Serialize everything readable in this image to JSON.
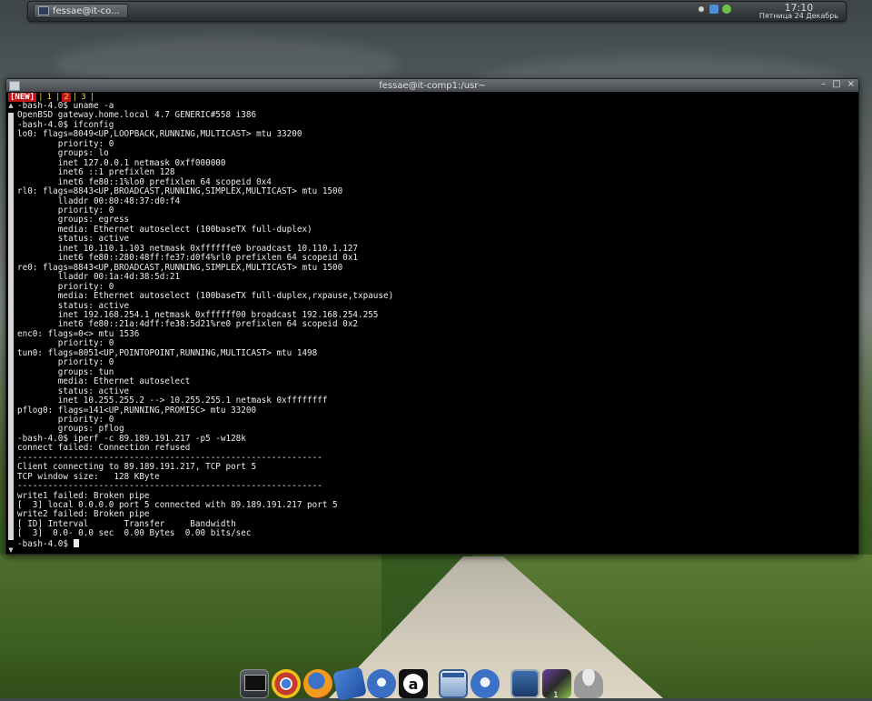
{
  "panel": {
    "task_label": "fessae@it-co...",
    "clock_time": "17:10",
    "clock_date": "Пятница 24 Декабрь"
  },
  "window": {
    "title": "fessae@it-comp1:/usr~",
    "controls": {
      "minimize": "–",
      "maximize": "□",
      "close": "×"
    }
  },
  "tabs": {
    "new_label": "[NEW]",
    "items": [
      "1",
      "2",
      "3"
    ]
  },
  "terminal_lines": [
    "-bash-4.0$ uname -a",
    "OpenBSD gateway.home.local 4.7 GENERIC#558 i386",
    "-bash-4.0$ ifconfig",
    "lo0: flags=8049<UP,LOOPBACK,RUNNING,MULTICAST> mtu 33200",
    "        priority: 0",
    "        groups: lo",
    "        inet 127.0.0.1 netmask 0xff000000",
    "        inet6 ::1 prefixlen 128",
    "        inet6 fe80::1%lo0 prefixlen 64 scopeid 0x4",
    "rl0: flags=8843<UP,BROADCAST,RUNNING,SIMPLEX,MULTICAST> mtu 1500",
    "        lladdr 00:80:48:37:d0:f4",
    "        priority: 0",
    "        groups: egress",
    "        media: Ethernet autoselect (100baseTX full-duplex)",
    "        status: active",
    "        inet 10.110.1.103 netmask 0xffffffe0 broadcast 10.110.1.127",
    "        inet6 fe80::280:48ff:fe37:d0f4%rl0 prefixlen 64 scopeid 0x1",
    "re0: flags=8843<UP,BROADCAST,RUNNING,SIMPLEX,MULTICAST> mtu 1500",
    "        lladdr 00:1a:4d:38:5d:21",
    "        priority: 0",
    "        media: Ethernet autoselect (100baseTX full-duplex,rxpause,txpause)",
    "        status: active",
    "        inet 192.168.254.1 netmask 0xffffff00 broadcast 192.168.254.255",
    "        inet6 fe80::21a:4dff:fe38:5d21%re0 prefixlen 64 scopeid 0x2",
    "enc0: flags=0<> mtu 1536",
    "        priority: 0",
    "tun0: flags=8051<UP,POINTOPOINT,RUNNING,MULTICAST> mtu 1498",
    "        priority: 0",
    "        groups: tun",
    "        media: Ethernet autoselect",
    "        status: active",
    "        inet 10.255.255.2 --> 10.255.255.1 netmask 0xffffffff",
    "pflog0: flags=141<UP,RUNNING,PROMISC> mtu 33200",
    "        priority: 0",
    "        groups: pflog",
    "-bash-4.0$ iperf -c 89.189.191.217 -p5 -w128k",
    "connect failed: Connection refused",
    "------------------------------------------------------------",
    "Client connecting to 89.189.191.217, TCP port 5",
    "TCP window size:   128 KByte",
    "------------------------------------------------------------",
    "write1 failed: Broken pipe",
    "[  3] local 0.0.0.0 port 5 connected with 89.189.191.217 port 5",
    "write2 failed: Broken pipe",
    "[ ID] Interval       Transfer     Bandwidth",
    "[  3]  0.0- 0.0 sec  0.00 Bytes  0.00 bits/sec"
  ],
  "prompt": "-bash-4.0$ ",
  "dock": {
    "gallery_badge": "1",
    "items": [
      "terminal-icon",
      "chrome-icon",
      "firefox-icon",
      "network-icon",
      "thunderbird-icon",
      "a-icon",
      "window-icon",
      "thunderbird-alt-icon",
      "monitor-icon",
      "gallery-icon",
      "trash-icon"
    ]
  }
}
